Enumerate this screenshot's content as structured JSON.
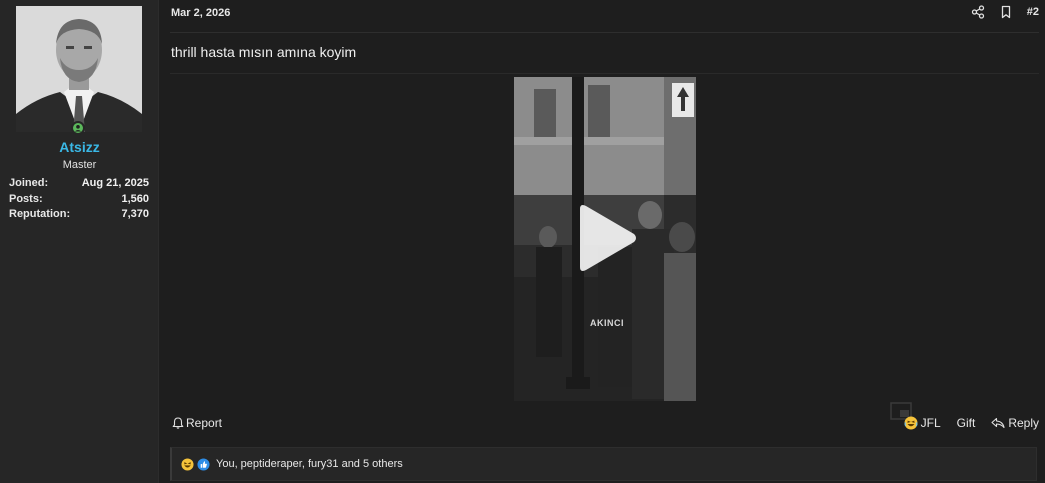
{
  "user": {
    "username": "Atsizz",
    "title": "Master",
    "online": true,
    "stats": [
      {
        "key": "Joined:",
        "value": "Aug 21, 2025"
      },
      {
        "key": "Posts:",
        "value": "1,560"
      },
      {
        "key": "Reputation:",
        "value": "7,370"
      }
    ]
  },
  "post": {
    "date": "Mar 2, 2026",
    "number": "#2",
    "text": "thrill hasta mısın amına koyim",
    "video": {
      "watermark": "AKINCI"
    }
  },
  "footer": {
    "report_label": "Report",
    "reaction_label": "JFL",
    "gift_label": "Gift",
    "reply_label": "Reply"
  },
  "reactions": {
    "summary": "You, peptideraper, fury31 and 5 others"
  },
  "colors": {
    "username": "#3ab8e6",
    "online": "#5cb85c",
    "background": "#1e1e1e",
    "sidebar": "#262626"
  }
}
